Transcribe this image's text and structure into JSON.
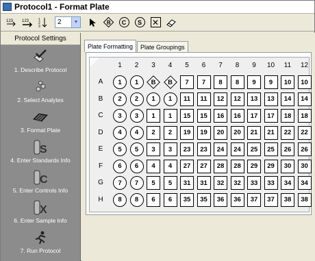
{
  "window": {
    "title": "Protocol1 - Format Plate"
  },
  "toolbar": {
    "replicate_count": "2",
    "circle_buttons": [
      "C",
      "S"
    ],
    "diamond_button": "B"
  },
  "sidebar": {
    "header": "Protocol Settings",
    "items": [
      {
        "label": "1. Describe Protocol",
        "icon": "checkmark-pen-icon"
      },
      {
        "label": "2. Select Analytes",
        "icon": "beads-icon"
      },
      {
        "label": "3. Format Plate",
        "icon": "plate-icon"
      },
      {
        "label": "4. Enter Standards Info",
        "icon": "tube-s-icon"
      },
      {
        "label": "5. Enter Controls Info",
        "icon": "tube-c-icon"
      },
      {
        "label": "6. Enter Sample Info",
        "icon": "tube-x-icon"
      },
      {
        "label": "7. Run Protocol",
        "icon": "runner-icon"
      }
    ]
  },
  "tabs": [
    "Plate Formatting",
    "Plate Groupings"
  ],
  "plate": {
    "columns": [
      "1",
      "2",
      "3",
      "4",
      "5",
      "6",
      "7",
      "8",
      "9",
      "10",
      "11",
      "12"
    ],
    "rows": [
      {
        "label": "A",
        "wells": [
          [
            "S",
            "1"
          ],
          [
            "S",
            "1"
          ],
          [
            "C",
            "B"
          ],
          [
            "C",
            "B"
          ],
          [
            "X",
            "7"
          ],
          [
            "X",
            "7"
          ],
          [
            "X",
            "8"
          ],
          [
            "X",
            "8"
          ],
          [
            "X",
            "9"
          ],
          [
            "X",
            "9"
          ],
          [
            "X",
            "10"
          ],
          [
            "X",
            "10"
          ]
        ]
      },
      {
        "label": "B",
        "wells": [
          [
            "S",
            "2"
          ],
          [
            "S",
            "2"
          ],
          [
            "S",
            "1"
          ],
          [
            "S",
            "1"
          ],
          [
            "X",
            "11"
          ],
          [
            "X",
            "11"
          ],
          [
            "X",
            "12"
          ],
          [
            "X",
            "12"
          ],
          [
            "X",
            "13"
          ],
          [
            "X",
            "13"
          ],
          [
            "X",
            "14"
          ],
          [
            "X",
            "14"
          ]
        ]
      },
      {
        "label": "C",
        "wells": [
          [
            "S",
            "3"
          ],
          [
            "S",
            "3"
          ],
          [
            "X",
            "1"
          ],
          [
            "X",
            "1"
          ],
          [
            "X",
            "15"
          ],
          [
            "X",
            "15"
          ],
          [
            "X",
            "16"
          ],
          [
            "X",
            "16"
          ],
          [
            "X",
            "17"
          ],
          [
            "X",
            "17"
          ],
          [
            "X",
            "18"
          ],
          [
            "X",
            "18"
          ]
        ]
      },
      {
        "label": "D",
        "wells": [
          [
            "S",
            "4"
          ],
          [
            "S",
            "4"
          ],
          [
            "X",
            "2"
          ],
          [
            "X",
            "2"
          ],
          [
            "X",
            "19"
          ],
          [
            "X",
            "19"
          ],
          [
            "X",
            "20"
          ],
          [
            "X",
            "20"
          ],
          [
            "X",
            "21"
          ],
          [
            "X",
            "21"
          ],
          [
            "X",
            "22"
          ],
          [
            "X",
            "22"
          ]
        ]
      },
      {
        "label": "E",
        "wells": [
          [
            "S",
            "5"
          ],
          [
            "S",
            "5"
          ],
          [
            "X",
            "3"
          ],
          [
            "X",
            "3"
          ],
          [
            "X",
            "23"
          ],
          [
            "X",
            "23"
          ],
          [
            "X",
            "24"
          ],
          [
            "X",
            "24"
          ],
          [
            "X",
            "25"
          ],
          [
            "X",
            "25"
          ],
          [
            "X",
            "26"
          ],
          [
            "X",
            "26"
          ]
        ]
      },
      {
        "label": "F",
        "wells": [
          [
            "S",
            "6"
          ],
          [
            "S",
            "6"
          ],
          [
            "X",
            "4"
          ],
          [
            "X",
            "4"
          ],
          [
            "X",
            "27"
          ],
          [
            "X",
            "27"
          ],
          [
            "X",
            "28"
          ],
          [
            "X",
            "28"
          ],
          [
            "X",
            "29"
          ],
          [
            "X",
            "29"
          ],
          [
            "X",
            "30"
          ],
          [
            "X",
            "30"
          ]
        ]
      },
      {
        "label": "G",
        "wells": [
          [
            "S",
            "7"
          ],
          [
            "S",
            "7"
          ],
          [
            "X",
            "5"
          ],
          [
            "X",
            "5"
          ],
          [
            "X",
            "31"
          ],
          [
            "X",
            "31"
          ],
          [
            "X",
            "32"
          ],
          [
            "X",
            "32"
          ],
          [
            "X",
            "33"
          ],
          [
            "X",
            "33"
          ],
          [
            "X",
            "34"
          ],
          [
            "X",
            "34"
          ]
        ]
      },
      {
        "label": "H",
        "wells": [
          [
            "S",
            "8"
          ],
          [
            "S",
            "8"
          ],
          [
            "X",
            "6"
          ],
          [
            "X",
            "6"
          ],
          [
            "X",
            "35"
          ],
          [
            "X",
            "35"
          ],
          [
            "X",
            "36"
          ],
          [
            "X",
            "36"
          ],
          [
            "X",
            "37"
          ],
          [
            "X",
            "37"
          ],
          [
            "X",
            "38"
          ],
          [
            "X",
            "38"
          ]
        ]
      }
    ]
  }
}
